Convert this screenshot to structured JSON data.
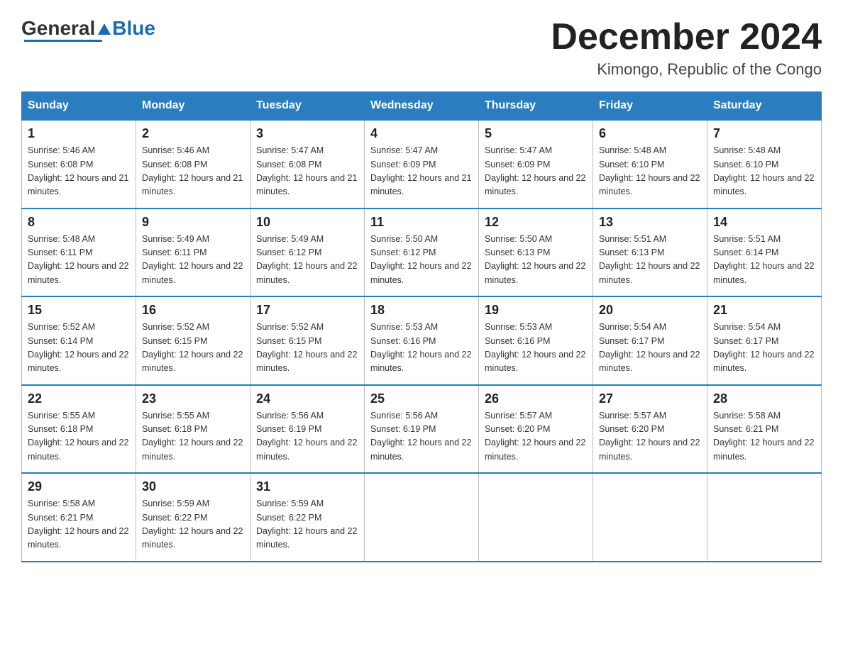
{
  "header": {
    "logo_general": "General",
    "logo_blue": "Blue",
    "month_title": "December 2024",
    "location": "Kimongo, Republic of the Congo"
  },
  "weekdays": [
    "Sunday",
    "Monday",
    "Tuesday",
    "Wednesday",
    "Thursday",
    "Friday",
    "Saturday"
  ],
  "weeks": [
    [
      {
        "day": "1",
        "sunrise": "5:46 AM",
        "sunset": "6:08 PM",
        "daylight": "12 hours and 21 minutes."
      },
      {
        "day": "2",
        "sunrise": "5:46 AM",
        "sunset": "6:08 PM",
        "daylight": "12 hours and 21 minutes."
      },
      {
        "day": "3",
        "sunrise": "5:47 AM",
        "sunset": "6:08 PM",
        "daylight": "12 hours and 21 minutes."
      },
      {
        "day": "4",
        "sunrise": "5:47 AM",
        "sunset": "6:09 PM",
        "daylight": "12 hours and 21 minutes."
      },
      {
        "day": "5",
        "sunrise": "5:47 AM",
        "sunset": "6:09 PM",
        "daylight": "12 hours and 22 minutes."
      },
      {
        "day": "6",
        "sunrise": "5:48 AM",
        "sunset": "6:10 PM",
        "daylight": "12 hours and 22 minutes."
      },
      {
        "day": "7",
        "sunrise": "5:48 AM",
        "sunset": "6:10 PM",
        "daylight": "12 hours and 22 minutes."
      }
    ],
    [
      {
        "day": "8",
        "sunrise": "5:48 AM",
        "sunset": "6:11 PM",
        "daylight": "12 hours and 22 minutes."
      },
      {
        "day": "9",
        "sunrise": "5:49 AM",
        "sunset": "6:11 PM",
        "daylight": "12 hours and 22 minutes."
      },
      {
        "day": "10",
        "sunrise": "5:49 AM",
        "sunset": "6:12 PM",
        "daylight": "12 hours and 22 minutes."
      },
      {
        "day": "11",
        "sunrise": "5:50 AM",
        "sunset": "6:12 PM",
        "daylight": "12 hours and 22 minutes."
      },
      {
        "day": "12",
        "sunrise": "5:50 AM",
        "sunset": "6:13 PM",
        "daylight": "12 hours and 22 minutes."
      },
      {
        "day": "13",
        "sunrise": "5:51 AM",
        "sunset": "6:13 PM",
        "daylight": "12 hours and 22 minutes."
      },
      {
        "day": "14",
        "sunrise": "5:51 AM",
        "sunset": "6:14 PM",
        "daylight": "12 hours and 22 minutes."
      }
    ],
    [
      {
        "day": "15",
        "sunrise": "5:52 AM",
        "sunset": "6:14 PM",
        "daylight": "12 hours and 22 minutes."
      },
      {
        "day": "16",
        "sunrise": "5:52 AM",
        "sunset": "6:15 PM",
        "daylight": "12 hours and 22 minutes."
      },
      {
        "day": "17",
        "sunrise": "5:52 AM",
        "sunset": "6:15 PM",
        "daylight": "12 hours and 22 minutes."
      },
      {
        "day": "18",
        "sunrise": "5:53 AM",
        "sunset": "6:16 PM",
        "daylight": "12 hours and 22 minutes."
      },
      {
        "day": "19",
        "sunrise": "5:53 AM",
        "sunset": "6:16 PM",
        "daylight": "12 hours and 22 minutes."
      },
      {
        "day": "20",
        "sunrise": "5:54 AM",
        "sunset": "6:17 PM",
        "daylight": "12 hours and 22 minutes."
      },
      {
        "day": "21",
        "sunrise": "5:54 AM",
        "sunset": "6:17 PM",
        "daylight": "12 hours and 22 minutes."
      }
    ],
    [
      {
        "day": "22",
        "sunrise": "5:55 AM",
        "sunset": "6:18 PM",
        "daylight": "12 hours and 22 minutes."
      },
      {
        "day": "23",
        "sunrise": "5:55 AM",
        "sunset": "6:18 PM",
        "daylight": "12 hours and 22 minutes."
      },
      {
        "day": "24",
        "sunrise": "5:56 AM",
        "sunset": "6:19 PM",
        "daylight": "12 hours and 22 minutes."
      },
      {
        "day": "25",
        "sunrise": "5:56 AM",
        "sunset": "6:19 PM",
        "daylight": "12 hours and 22 minutes."
      },
      {
        "day": "26",
        "sunrise": "5:57 AM",
        "sunset": "6:20 PM",
        "daylight": "12 hours and 22 minutes."
      },
      {
        "day": "27",
        "sunrise": "5:57 AM",
        "sunset": "6:20 PM",
        "daylight": "12 hours and 22 minutes."
      },
      {
        "day": "28",
        "sunrise": "5:58 AM",
        "sunset": "6:21 PM",
        "daylight": "12 hours and 22 minutes."
      }
    ],
    [
      {
        "day": "29",
        "sunrise": "5:58 AM",
        "sunset": "6:21 PM",
        "daylight": "12 hours and 22 minutes."
      },
      {
        "day": "30",
        "sunrise": "5:59 AM",
        "sunset": "6:22 PM",
        "daylight": "12 hours and 22 minutes."
      },
      {
        "day": "31",
        "sunrise": "5:59 AM",
        "sunset": "6:22 PM",
        "daylight": "12 hours and 22 minutes."
      },
      null,
      null,
      null,
      null
    ]
  ],
  "labels": {
    "sunrise_prefix": "Sunrise: ",
    "sunset_prefix": "Sunset: ",
    "daylight_prefix": "Daylight: "
  }
}
